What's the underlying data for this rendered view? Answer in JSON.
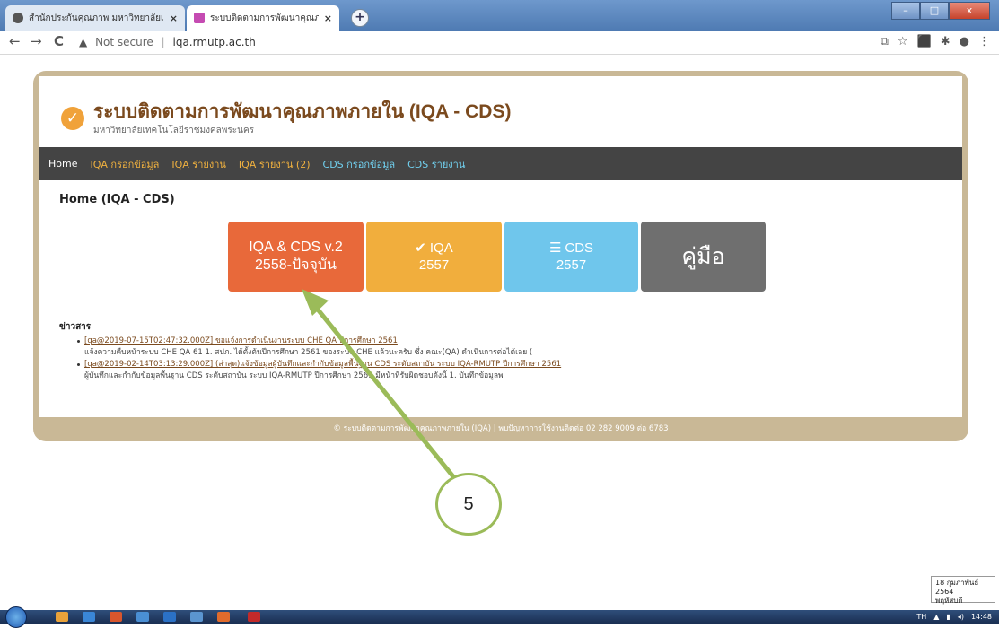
{
  "browser": {
    "tabs": [
      {
        "title": "สำนักประกันคุณภาพ มหาวิทยาลัยเ",
        "close": "×"
      },
      {
        "title": "ระบบติดตามการพัฒนาคุณภาพภายใ",
        "close": "×"
      }
    ],
    "new_tab": "+",
    "window_controls": {
      "minimize": "–",
      "maximize": "□",
      "close": "x"
    },
    "nav": {
      "back": "←",
      "forward": "→",
      "reload": "C"
    },
    "address": {
      "warning": "▲",
      "security_text": "Not secure",
      "separator": "|",
      "url": "iqa.rmutp.ac.th"
    },
    "toolbar_icons": [
      "translate-icon",
      "star-icon",
      "pdf-icon",
      "extensions-icon",
      "profile-icon",
      "menu-icon"
    ]
  },
  "site": {
    "title": "ระบบติดตามการพัฒนาคุณภาพภายใน (IQA - CDS)",
    "subtitle": "มหาวิทยาลัยเทคโนโลยีราชมงคลพระนคร",
    "menu": [
      "Home",
      "IQA กรอกข้อมูล",
      "IQA รายงาน",
      "IQA รายงาน (2)",
      "CDS กรอกข้อมูล",
      "CDS รายงาน"
    ],
    "page_heading": "Home (IQA - CDS)",
    "tiles": {
      "v2": {
        "line1": "IQA & CDS v.2",
        "line2": "2558-ปัจจุบัน"
      },
      "iqa": {
        "line1": "IQA",
        "line2": "2557"
      },
      "cds": {
        "line1": "CDS",
        "line2": "2557"
      },
      "manual": {
        "label": "คู่มือ"
      }
    },
    "news": {
      "title": "ข่าวสาร",
      "items": [
        {
          "link": "[qa@2019-07-15T02:47:32.000Z] ขอแจ้งการดำเนินงานระบบ CHE QA ปีการศึกษา 2561",
          "desc": "แจ้งความคืบหน้าระบบ CHE QA 61 1. สปภ. ได้ตั้งต้นปีการศึกษา 2561 ของระบบ CHE แล้วนะครับ ซึ่ง คณะ(QA) ดำเนินการต่อได้เลย ("
        },
        {
          "link": "[qa@2019-02-14T03:13:29.000Z] (ล่าสุด)แจ้งข้อมูลผู้บันทึกและกำกับข้อมูลพื้นฐาน CDS ระดับสถาบัน ระบบ IQA-RMUTP ปีการศึกษา 2561",
          "desc": "ผู้บันทึกและกำกับข้อมูลพื้นฐาน CDS ระดับสถาบัน ระบบ IQA-RMUTP ปีการศึกษา 2561 มีหน้าที่รับผิดชอบดังนี้ 1.  บันทึกข้อมูลพ"
        }
      ]
    },
    "footer": "© ระบบติดตามการพัฒนาคุณภาพภายใน (IQA) | พบปัญหาการใช้งานติดต่อ 02 282 9009 ต่อ 6783"
  },
  "annotation": {
    "label": "5",
    "color": "#9bbb59"
  },
  "taskbar": {
    "language": "TH",
    "time": "14:48",
    "date_popup": {
      "line1": "18 กุมภาพันธ์ 2564",
      "line2": "พฤหัสบดี"
    }
  },
  "colors": {
    "accent_orange": "#e8693a",
    "iqa_yellow": "#f1ae3d",
    "cds_blue": "#6fc6ec",
    "manual_gray": "#6f6f6f",
    "frame_tan": "#c9b896",
    "menu_bg": "#444444"
  }
}
